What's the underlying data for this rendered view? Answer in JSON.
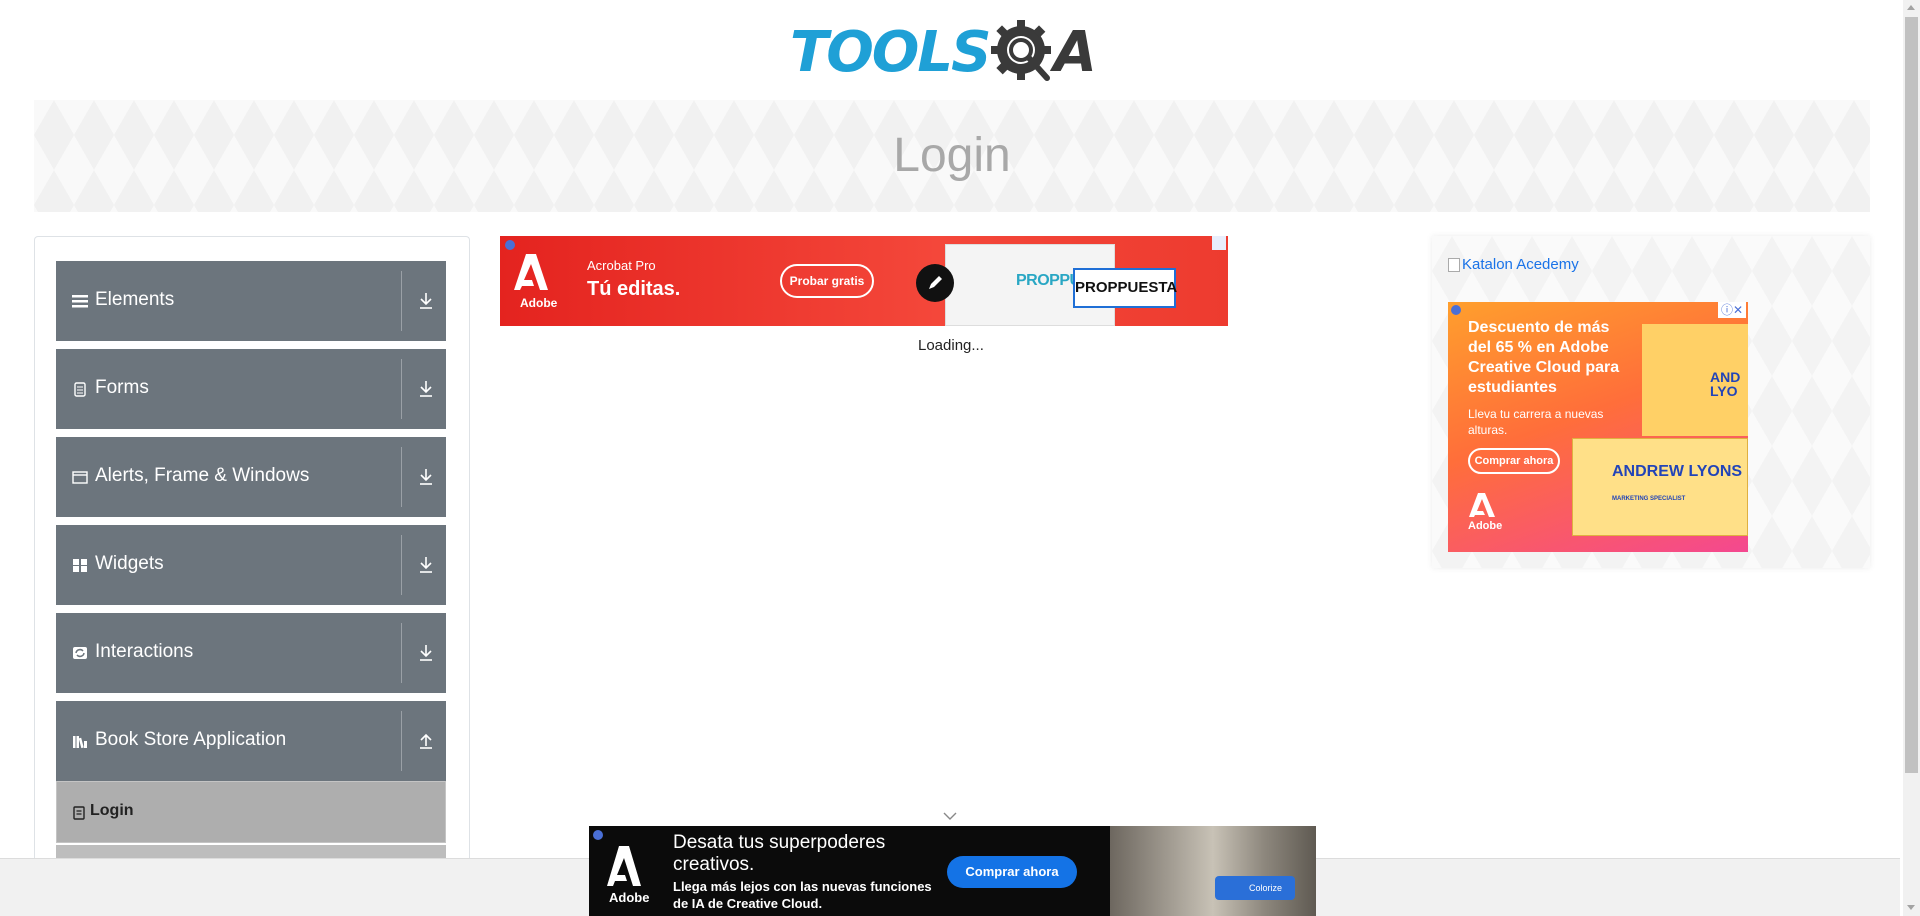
{
  "header": {
    "logo_text": "TOOLS",
    "logo_suffix": "A",
    "logo_colors": {
      "tools": "#1fa0d6",
      "qa": "#3a3a3a"
    }
  },
  "banner": {
    "title": "Login"
  },
  "sidebar": {
    "groups": [
      {
        "label": "Elements",
        "icon": "hamburger-icon",
        "expanded": false
      },
      {
        "label": "Forms",
        "icon": "document-icon",
        "expanded": false
      },
      {
        "label": "Alerts, Frame & Windows",
        "icon": "window-icon",
        "expanded": false
      },
      {
        "label": "Widgets",
        "icon": "widgets-grid-icon",
        "expanded": false
      },
      {
        "label": "Interactions",
        "icon": "interactions-icon",
        "expanded": false
      },
      {
        "label": "Book Store Application",
        "icon": "books-icon",
        "expanded": true
      }
    ],
    "book_store_items": [
      {
        "label": "Login",
        "icon": "id-card-icon",
        "active": true
      }
    ],
    "group_bg": "#6c757d"
  },
  "main": {
    "loading_text": "Loading..."
  },
  "ad_top": {
    "brand": "Adobe",
    "product": "Acrobat Pro",
    "headline": "Tú editas.",
    "cta": "Probar gratis",
    "doc_text": "PROPPUESTA",
    "selection_text": "PROPPUESTA"
  },
  "right": {
    "link_text": "Katalon Acedemy",
    "ad": {
      "headline": "Descuento de más del 65 % en Adobe Creative Cloud para estudiantes",
      "sub": "Lleva tu carrera a nuevas alturas.",
      "cta": "Comprar ahora",
      "brand": "Adobe",
      "card1_text": "AND LYO",
      "card2_name": "ANDREW LYONS",
      "card2_role": "MARKETING SPECIALIST"
    }
  },
  "ad_bottom": {
    "brand": "Adobe",
    "headline": "Desata tus superpoderes creativos.",
    "sub": "Llega más lejos con las nuevas funciones de IA de Creative Cloud.",
    "cta": "Comprar ahora",
    "colorize": "Colorize"
  }
}
